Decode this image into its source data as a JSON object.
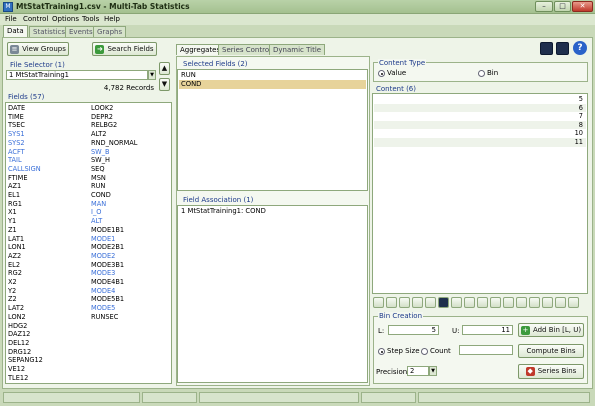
{
  "window": {
    "title": "MtStatTraining1.csv - Multi-Tab Statistics",
    "minimize": "–",
    "maximize": "□",
    "close": "✕"
  },
  "menu": [
    "File",
    "Control",
    "Options",
    "Tools",
    "Help"
  ],
  "main_tabs": [
    "Data",
    "Statistics",
    "Events",
    "Graphs"
  ],
  "left": {
    "view_groups": "View Groups",
    "search_fields": "Search Fields",
    "file_selector_title": "File Selector (1)",
    "file_selected": "1   MtStatTraining1",
    "records": "4,782 Records",
    "fields_title": "Fields (57)",
    "fields_col1": [
      {
        "name": "DATE",
        "blue": false
      },
      {
        "name": "TIME",
        "blue": false
      },
      {
        "name": "TSEC",
        "blue": false
      },
      {
        "name": "SYS1",
        "blue": true
      },
      {
        "name": "SYS2",
        "blue": true
      },
      {
        "name": "ACFT",
        "blue": true
      },
      {
        "name": "TAIL",
        "blue": true
      },
      {
        "name": "CALLSIGN",
        "blue": true
      },
      {
        "name": "FTIME",
        "blue": false
      },
      {
        "name": "AZ1",
        "blue": false
      },
      {
        "name": "EL1",
        "blue": false
      },
      {
        "name": "RG1",
        "blue": false
      },
      {
        "name": "X1",
        "blue": false
      },
      {
        "name": "Y1",
        "blue": false
      },
      {
        "name": "Z1",
        "blue": false
      },
      {
        "name": "LAT1",
        "blue": false
      },
      {
        "name": "LON1",
        "blue": false
      },
      {
        "name": "AZ2",
        "blue": false
      },
      {
        "name": "EL2",
        "blue": false
      },
      {
        "name": "RG2",
        "blue": false
      },
      {
        "name": "X2",
        "blue": false
      },
      {
        "name": "Y2",
        "blue": false
      },
      {
        "name": "Z2",
        "blue": false
      },
      {
        "name": "LAT2",
        "blue": false
      },
      {
        "name": "LON2",
        "blue": false
      },
      {
        "name": "HDG2",
        "blue": false
      },
      {
        "name": "DAZ12",
        "blue": false
      },
      {
        "name": "DEL12",
        "blue": false
      },
      {
        "name": "DRG12",
        "blue": false
      },
      {
        "name": "SEPANG12",
        "blue": false
      },
      {
        "name": "VE12",
        "blue": false
      },
      {
        "name": "TLE12",
        "blue": false
      }
    ],
    "fields_col2": [
      {
        "name": "LOOK2",
        "blue": false
      },
      {
        "name": "DEPR2",
        "blue": false
      },
      {
        "name": "RELBG2",
        "blue": false
      },
      {
        "name": "ALT2",
        "blue": false
      },
      {
        "name": "RND_NORMAL",
        "blue": false
      },
      {
        "name": "SW_B",
        "blue": true
      },
      {
        "name": "SW_H",
        "blue": false
      },
      {
        "name": "SEQ",
        "blue": false
      },
      {
        "name": "MSN",
        "blue": false
      },
      {
        "name": "RUN",
        "blue": false
      },
      {
        "name": "COND",
        "blue": false
      },
      {
        "name": "MAN",
        "blue": true
      },
      {
        "name": "I_O",
        "blue": true
      },
      {
        "name": "ALT",
        "blue": true
      },
      {
        "name": "MODE1B1",
        "blue": false
      },
      {
        "name": "MODE1",
        "blue": true
      },
      {
        "name": "MODE2B1",
        "blue": false
      },
      {
        "name": "MODE2",
        "blue": true
      },
      {
        "name": "MODE3B1",
        "blue": false
      },
      {
        "name": "MODE3",
        "blue": true
      },
      {
        "name": "MODE4B1",
        "blue": false
      },
      {
        "name": "MODE4",
        "blue": true
      },
      {
        "name": "MODE5B1",
        "blue": false
      },
      {
        "name": "MODE5",
        "blue": true
      },
      {
        "name": "RUNSEC",
        "blue": false
      }
    ]
  },
  "center": {
    "tabs": [
      "Aggregates",
      "Series Control",
      "Dynamic Title"
    ],
    "selected_title": "Selected Fields (2)",
    "selected": [
      {
        "name": "RUN",
        "sel": false
      },
      {
        "name": "COND",
        "sel": true
      }
    ],
    "assoc_title": "Field Association (1)",
    "assoc": [
      "1   MtStatTraining1: COND"
    ]
  },
  "right": {
    "content_type_title": "Content Type",
    "value_label": "Value",
    "bin_label": "Bin",
    "content_title": "Content (6)",
    "content_values": [
      "5",
      "6",
      "7",
      "8",
      "10",
      "11"
    ],
    "bin_creation_title": "Bin Creation",
    "l_label": "L:",
    "l_value": "5",
    "u_label": "U:",
    "u_value": "11",
    "add_bin": "Add Bin [L, U)",
    "step_size": "Step Size",
    "count": "Count",
    "compute_bins": "Compute Bins",
    "precision_label": "Precision:",
    "precision_value": "2",
    "series_bins": "Series Bins"
  },
  "colors": {
    "accent_green": "#3c9a3c",
    "selection": "#e7d39a",
    "blue_field": "#3a6fd8"
  }
}
